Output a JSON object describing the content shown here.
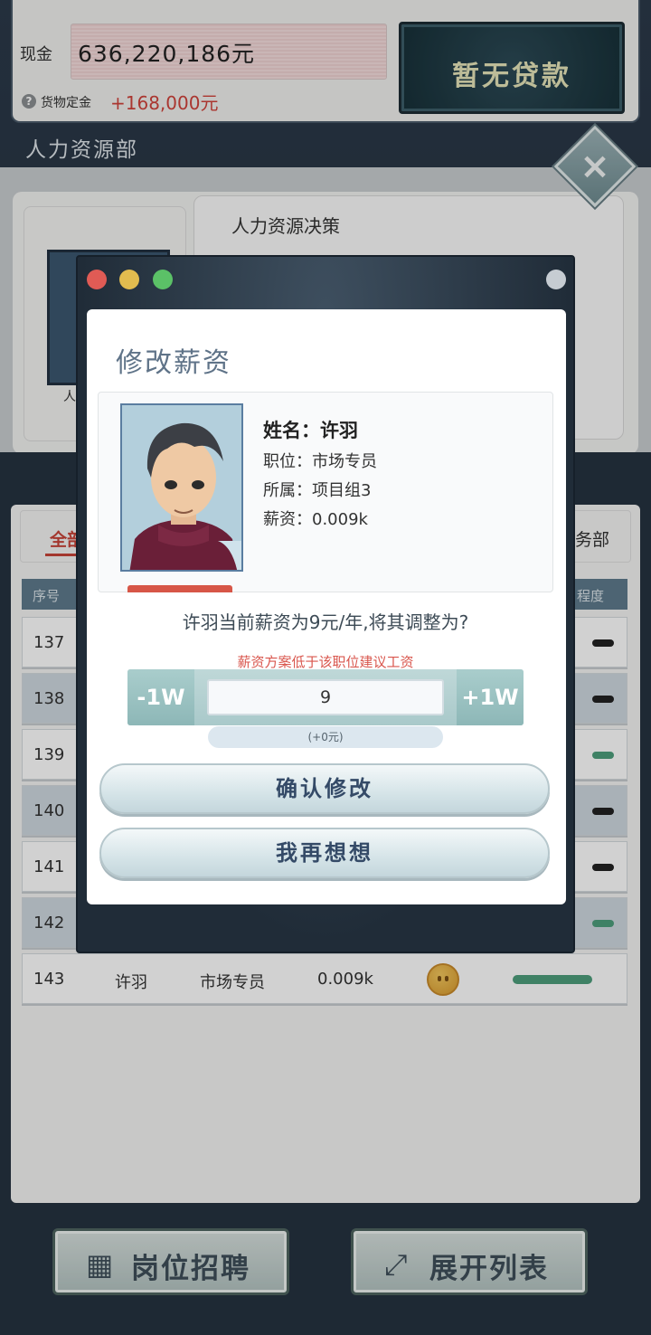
{
  "finance": {
    "cash_label": "现金",
    "cash_value": "636,220,186元",
    "deposit_help_icon": "?",
    "deposit_label": "货物定金",
    "deposit_value": "+168,000元",
    "loan_button": "暂无贷款"
  },
  "page": {
    "department_title": "人力资源部",
    "decision_card_title": "人力资源决策",
    "left_card_text": "人",
    "close_icon": "×"
  },
  "employee_list": {
    "tab_all": "全部",
    "tab_right": "务部",
    "columns": [
      "序号",
      "程度"
    ],
    "rows": [
      {
        "id": "137"
      },
      {
        "id": "138"
      },
      {
        "id": "139"
      },
      {
        "id": "140"
      },
      {
        "id": "141"
      },
      {
        "id": "142"
      },
      {
        "id": "143",
        "name": "许羽",
        "position": "市场专员",
        "salary": "0.009k",
        "mood_icon": "neutral-face-icon"
      }
    ]
  },
  "bottom_bar": {
    "recruit_label": "岗位招聘",
    "expand_label": "展开列表"
  },
  "modal": {
    "title": "修改薪资",
    "profile": {
      "name_line": "姓名：许羽",
      "position_line": "职位：市场专员",
      "group_line": "所属：项目组3",
      "salary_line": "薪资：0.009k"
    },
    "question": "许羽当前薪资为9元/年,将其调整为?",
    "warning": "薪资方案低于该职位建议工资",
    "minus_label": "-1W",
    "plus_label": "+1W",
    "salary_input_value": "9",
    "delta": "(+0元)",
    "confirm_label": "确认修改",
    "cancel_label": "我再想想"
  },
  "colors": {
    "accent_red": "#d0433b",
    "modal_title": "#5f7388",
    "button_text": "#344a67"
  }
}
